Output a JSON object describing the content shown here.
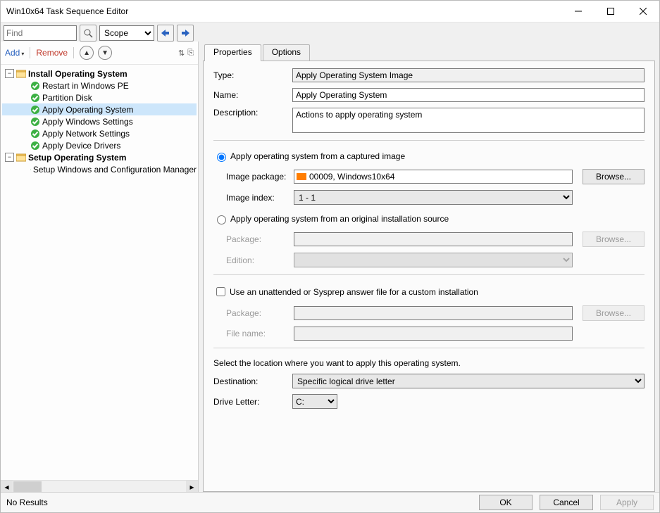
{
  "window": {
    "title": "Win10x64 Task Sequence Editor"
  },
  "toolbar": {
    "find_placeholder": "Find",
    "scope_value": "Scope"
  },
  "left": {
    "add": "Add",
    "remove": "Remove",
    "group1": "Install Operating System",
    "items1": [
      "Restart in Windows PE",
      "Partition Disk",
      "Apply Operating System",
      "Apply Windows Settings",
      "Apply Network Settings",
      "Apply Device Drivers"
    ],
    "group2": "Setup Operating System",
    "items2": [
      "Setup Windows and Configuration Manager"
    ]
  },
  "tabs": {
    "properties": "Properties",
    "options": "Options"
  },
  "form": {
    "type_label": "Type:",
    "type_value": "Apply Operating System Image",
    "name_label": "Name:",
    "name_value": "Apply Operating System",
    "desc_label": "Description:",
    "desc_value": "Actions to apply operating system",
    "radio1": "Apply operating system from a captured image",
    "imgpkg_label": "Image package:",
    "imgpkg_value": "00009, Windows10x64",
    "imgidx_label": "Image index:",
    "imgidx_value": "1 - 1",
    "browse": "Browse...",
    "radio2": "Apply operating system from an original installation source",
    "pkg_label": "Package:",
    "edition_label": "Edition:",
    "unattended": "Use an unattended or Sysprep answer file for a custom installation",
    "pkg2_label": "Package:",
    "file_label": "File name:",
    "dest_text": "Select the location where you want to apply this operating system.",
    "dest_label": "Destination:",
    "dest_value": "Specific logical drive letter",
    "drive_label": "Drive Letter:",
    "drive_value": "C:"
  },
  "status": {
    "text": "No Results"
  },
  "buttons": {
    "ok": "OK",
    "cancel": "Cancel",
    "apply": "Apply"
  }
}
